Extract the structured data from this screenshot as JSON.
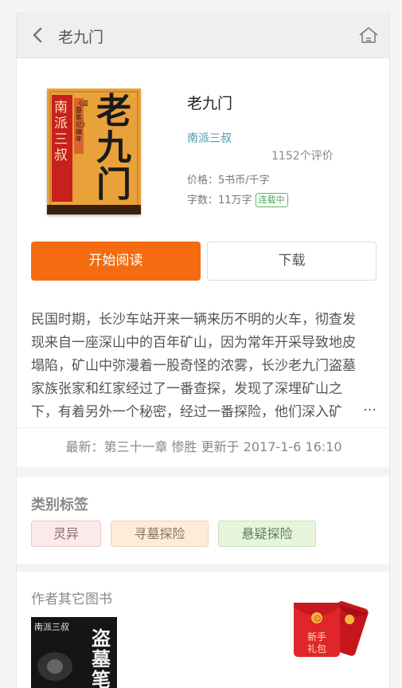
{
  "header": {
    "title": "老九门",
    "back_icon": "back-chevron-icon",
    "home_icon": "home-icon"
  },
  "book": {
    "name": "老九门",
    "author": "南派三叔",
    "reviews": "1152个评价",
    "price": "价格：5书币/千字",
    "words": "字数：11万字",
    "status_badge": "连载中",
    "cover": {
      "author_text": "南派三叔",
      "title_text": "老九门",
      "side_text": "《盗墓笔记》编年",
      "colors": {
        "background": "#e9a23a",
        "red_band": "#c8201c",
        "ink": "#1a1a1a"
      }
    }
  },
  "buttons": {
    "read": "开始阅读",
    "download": "下载"
  },
  "description": {
    "lines": [
      "民国时期，长沙车站开来一辆来历不明的火车，彻查发",
      "现来自一座深山中的百年矿山，因为常年开采导致地皮",
      "塌陷，矿山中弥漫着一股奇怪的浓雾，长沙老九门盗墓",
      "家族张家和红家经过了一番查探，发现了深埋矿山之",
      "下，有着另外一个秘密，经过一番探险，他们深入矿"
    ],
    "ellipsis": "…"
  },
  "latest": "最新：第三十一章 惨胜 更新于 2017-1-6 16:10",
  "categories": {
    "title": "类别标签",
    "tags": [
      "灵异",
      "寻墓探险",
      "悬疑探险"
    ]
  },
  "other_books": {
    "title": "作者其它图书",
    "cover": {
      "author_text": "南派三叔",
      "title_text": "盗墓笔"
    }
  },
  "red_packet": {
    "line1": "新手",
    "line2": "礼包",
    "colors": {
      "front": "#e0262c",
      "back": "#c4161c",
      "coin": "#f6b73c"
    }
  },
  "colors": {
    "accent": "#f46b10",
    "author_link": "#4a9aad",
    "badge": "#4aa650"
  }
}
